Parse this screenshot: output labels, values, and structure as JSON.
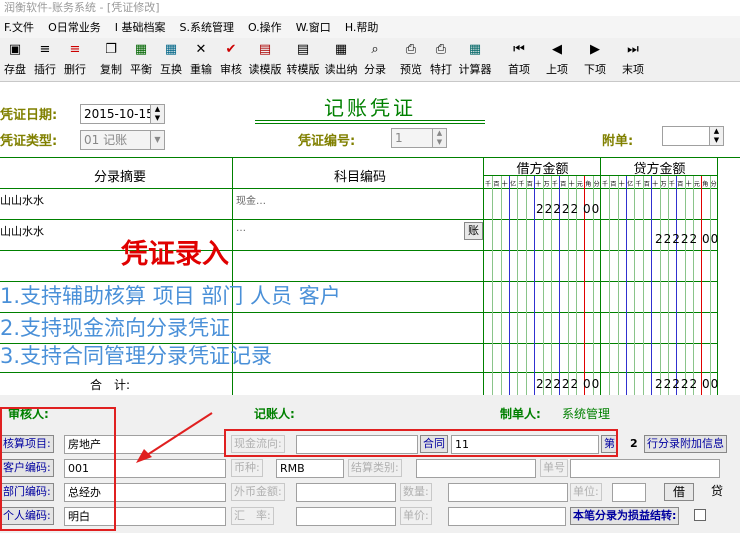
{
  "window": {
    "title": "润衡软件-账务系统 - [凭证修改]"
  },
  "menu": [
    "F.文件",
    "O日常业务",
    "I 基础档案",
    "S.系统管理",
    "O.操作",
    "W.窗口",
    "H.帮助"
  ],
  "toolbar": [
    {
      "label": "存盘",
      "icon": "save-icon",
      "glyph": "▣"
    },
    {
      "label": "插行",
      "icon": "insert-row-icon",
      "glyph": "≡"
    },
    {
      "label": "删行",
      "icon": "delete-row-icon",
      "glyph": "≡"
    },
    {
      "label": "复制",
      "icon": "copy-icon",
      "glyph": "❐"
    },
    {
      "label": "平衡",
      "icon": "balance-icon",
      "glyph": "▦"
    },
    {
      "label": "互换",
      "icon": "swap-icon",
      "glyph": "▦"
    },
    {
      "label": "重输",
      "icon": "clear-icon",
      "glyph": "✕"
    },
    {
      "label": "审核",
      "icon": "check-icon",
      "glyph": "✔"
    },
    {
      "label": "读模版",
      "icon": "read-template-icon",
      "glyph": "▤"
    },
    {
      "label": "转模版",
      "icon": "to-template-icon",
      "glyph": "▤"
    },
    {
      "label": "读出纳",
      "icon": "read-cashier-icon",
      "glyph": "▦"
    },
    {
      "label": "分录",
      "icon": "entry-icon",
      "glyph": "⌕"
    },
    {
      "label": "预览",
      "icon": "preview-icon",
      "glyph": "⎙"
    },
    {
      "label": "特打",
      "icon": "special-print-icon",
      "glyph": "⎙"
    },
    {
      "label": "计算器",
      "icon": "calculator-icon",
      "glyph": "▦"
    },
    {
      "label": "首项",
      "icon": "first-icon",
      "glyph": "⏮"
    },
    {
      "label": "上项",
      "icon": "prev-icon",
      "glyph": "◀"
    },
    {
      "label": "下项",
      "icon": "next-icon",
      "glyph": "▶"
    },
    {
      "label": "末项",
      "icon": "last-icon",
      "glyph": "⏭"
    }
  ],
  "voucher": {
    "title": "记账凭证",
    "date_label": "凭证日期:",
    "date_value": "2015-10-15",
    "type_label": "凭证类型:",
    "type_value": "01 记账",
    "number_label": "凭证编号:",
    "number_value": "1",
    "attach_label": "附单:",
    "attach_value": ""
  },
  "grid": {
    "col_summary": "分录摘要",
    "col_account": "科目编码",
    "col_debit": "借方金额",
    "col_credit": "贷方金额",
    "digit_headers": [
      "千",
      "百",
      "十",
      "亿",
      "千",
      "百",
      "十",
      "万",
      "千",
      "百",
      "十",
      "元",
      "角",
      "分"
    ],
    "rows": [
      {
        "summary": "山山水水",
        "account": "现金…",
        "debit": "22222",
        "debit_cents": "00",
        "credit": "",
        "credit_cents": ""
      },
      {
        "summary": "山山水水",
        "account": "…",
        "account_btn": "账",
        "debit": "",
        "debit_cents": "",
        "credit": "22222",
        "credit_cents": "00"
      }
    ],
    "total_label": "合　计:",
    "total_debit": "22222",
    "total_debit_cents": "00",
    "total_credit": "22222",
    "total_credit_cents": "00"
  },
  "overlay": {
    "heading": "凭证录入",
    "lines": [
      "1.支持辅助核算 项目 部门 人员 客户",
      "2.支持现金流向分录凭证",
      "3.支持合同管理分录凭证记录"
    ]
  },
  "signers": {
    "auditor_label": "审核人:",
    "bookkeeper_label": "记账人:",
    "maker_label": "制单人:",
    "maker_value": "系统管理"
  },
  "aux": {
    "project_btn": "核算项目:",
    "project_value": "房地产",
    "customer_btn": "客户编码:",
    "customer_value": "001",
    "dept_btn": "部门编码:",
    "dept_value": "总经办",
    "person_btn": "个人编码:",
    "person_value": "明白"
  },
  "extra": {
    "cashflow_btn": "现金流向:",
    "cashflow_value": "",
    "contract_btn": "合同",
    "contract_value": "11",
    "page_btn": "第",
    "page_num": "2",
    "entry_info_btn": "行分录附加信息",
    "currency_label": "币种:",
    "currency_value": "RMB",
    "settle_label": "结算类别:",
    "settle_value": "",
    "doc_label": "单号",
    "doc_value": "",
    "fx_amount_label": "外币金额:",
    "fx_amount_value": "",
    "qty_label": "数量:",
    "qty_value": "",
    "unit_label": "单位:",
    "unit_value": "",
    "debit_btn": "借",
    "credit_btn": "贷",
    "rate_label": "汇　率:",
    "rate_value": "",
    "price_label": "单价:",
    "price_value": "",
    "profit_label": "本笔分录为损益结转:"
  }
}
